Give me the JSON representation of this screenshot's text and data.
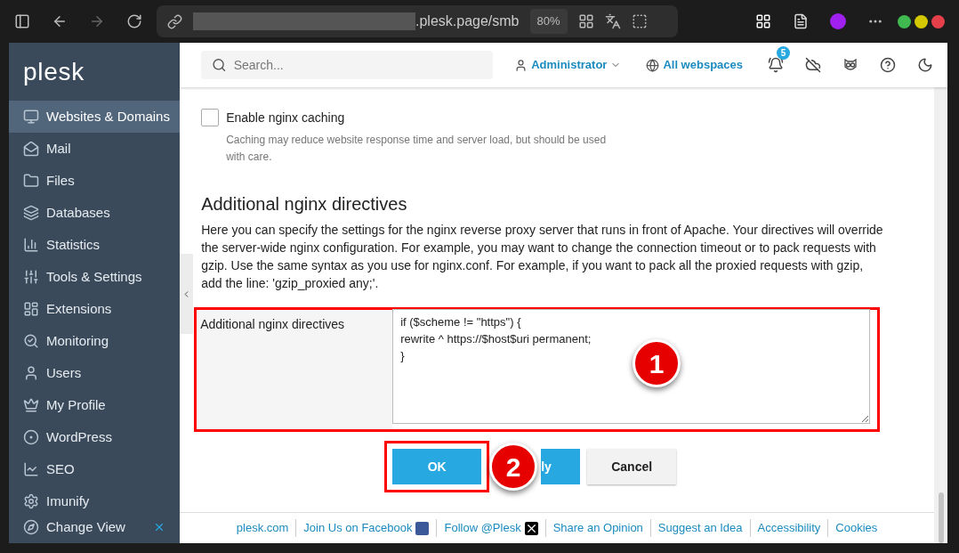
{
  "browser": {
    "url_host": ".plesk.page/smb",
    "zoom": "80%"
  },
  "sidebar": {
    "logo": "plesk",
    "items": [
      {
        "label": "Websites & Domains",
        "selected": true
      },
      {
        "label": "Mail",
        "selected": false
      },
      {
        "label": "Files",
        "selected": false
      },
      {
        "label": "Databases",
        "selected": false
      },
      {
        "label": "Statistics",
        "selected": false
      },
      {
        "label": "Tools & Settings",
        "selected": false
      },
      {
        "label": "Extensions",
        "selected": false
      },
      {
        "label": "Monitoring",
        "selected": false
      },
      {
        "label": "Users",
        "selected": false
      },
      {
        "label": "My Profile",
        "selected": false
      },
      {
        "label": "WordPress",
        "selected": false
      },
      {
        "label": "SEO",
        "selected": false
      },
      {
        "label": "Imunify",
        "selected": false
      }
    ],
    "change_view": "Change View"
  },
  "header": {
    "search_placeholder": "Search...",
    "user": "Administrator",
    "webspaces": "All webspaces",
    "notifications": "5"
  },
  "caching": {
    "label": "Enable nginx caching",
    "checked": false,
    "hint": "Caching may reduce website response time and server load, but should be used with care."
  },
  "section": {
    "title": "Additional nginx directives",
    "description": "Here you can specify the settings for the nginx reverse proxy server that runs in front of Apache. Your directives will override the server-wide nginx configuration. For example, you may want to change the connection timeout or to pack requests with gzip. Use the same syntax as you use for nginx.conf. For example, if you want to pack all the proxied requests with gzip, add the line: 'gzip_proxied any;'."
  },
  "field": {
    "label": "Additional nginx directives",
    "value": "if ($scheme != \"https\") {\nrewrite ^ https://$host$uri permanent;\n}"
  },
  "buttons": [
    {
      "label": "OK",
      "kind": "primary"
    },
    {
      "label": "ly",
      "kind": "primary"
    },
    {
      "label": "Cancel",
      "kind": "secondary"
    }
  ],
  "annotations": [
    "1",
    "2"
  ],
  "footer": [
    {
      "label": "plesk.com",
      "kind": "link"
    },
    {
      "label": "Join Us on Facebook",
      "kind": "facebook"
    },
    {
      "label": "Follow @Plesk",
      "kind": "x"
    },
    {
      "label": "Share an Opinion",
      "kind": "link"
    },
    {
      "label": "Suggest an Idea",
      "kind": "link"
    },
    {
      "label": "Accessibility",
      "kind": "link"
    },
    {
      "label": "Cookies",
      "kind": "link"
    }
  ]
}
